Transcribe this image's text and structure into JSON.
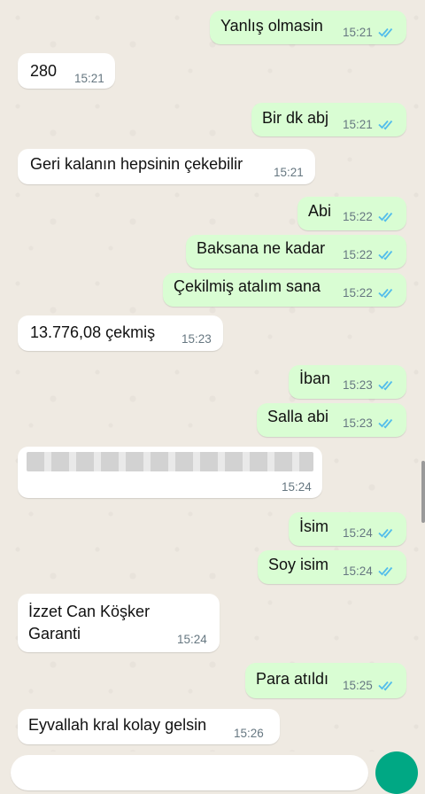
{
  "messages": [
    {
      "direction": "out",
      "text": "Yanlış olmasin",
      "time": "15:21",
      "read": true
    },
    {
      "direction": "in",
      "text": "280",
      "time": "15:21"
    },
    {
      "direction": "out",
      "text": "Bir dk abj",
      "time": "15:21",
      "read": true
    },
    {
      "direction": "in",
      "text": "Geri kalanın hepsinin çekebilir",
      "time": "15:21"
    },
    {
      "direction": "out",
      "text": "Abi",
      "time": "15:22",
      "read": true
    },
    {
      "direction": "out",
      "text": "Baksana ne kadar",
      "time": "15:22",
      "read": true
    },
    {
      "direction": "out",
      "text": "Çekilmiş atalım sana",
      "time": "15:22",
      "read": true
    },
    {
      "direction": "in",
      "text": "13.776,08 çekmiş",
      "time": "15:23"
    },
    {
      "direction": "out",
      "text": "İban",
      "time": "15:23",
      "read": true
    },
    {
      "direction": "out",
      "text": "Salla abi",
      "time": "15:23",
      "read": true
    },
    {
      "direction": "in",
      "text": "",
      "time": "15:24",
      "blurred": true
    },
    {
      "direction": "out",
      "text": "İsim",
      "time": "15:24",
      "read": true
    },
    {
      "direction": "out",
      "text": "Soy isim",
      "time": "15:24",
      "read": true
    },
    {
      "direction": "in",
      "text": "İzzet Can Köşker",
      "text2": "Garanti",
      "time": "15:24"
    },
    {
      "direction": "out",
      "text": "Para atıldı",
      "time": "15:25",
      "read": true
    },
    {
      "direction": "in",
      "text": "Eyvallah kral kolay gelsin",
      "time": "15:26"
    }
  ],
  "colors": {
    "chat_background": "#efeae2",
    "outgoing_bubble": "#d9fdd3",
    "incoming_bubble": "#ffffff",
    "read_ticks": "#53bdeb",
    "timestamp": "#667781",
    "accent": "#00a884"
  },
  "icons": {
    "read_receipt": "double-check-icon"
  }
}
